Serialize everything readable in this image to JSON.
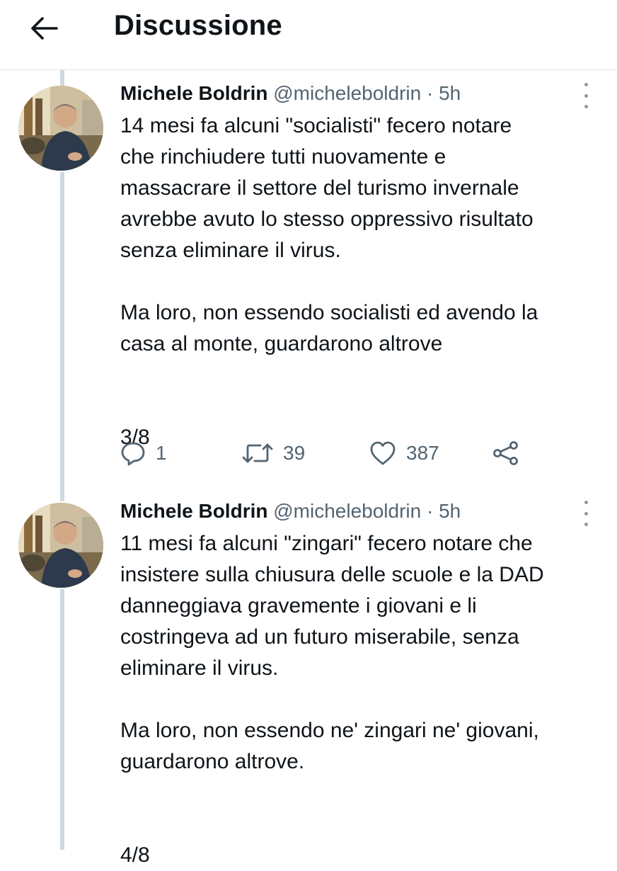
{
  "header": {
    "title": "Discussione"
  },
  "tweets": [
    {
      "name": "Michele Boldrin",
      "handle": "@micheleboldrin",
      "dot": "·",
      "time": "5h",
      "text": "14 mesi fa alcuni \"socialisti\" fecero notare\nche rinchiudere tutti nuovamente e\nmassacrare il settore del turismo invernale\navrebbe avuto lo stesso oppressivo risultato\nsenza eliminare il virus.\n\nMa loro, non essendo socialisti ed avendo la\ncasa al monte, guardarono altrove\n\n\n3/8",
      "replies": "1",
      "retweets": "39",
      "likes": "387"
    },
    {
      "name": "Michele Boldrin",
      "handle": "@micheleboldrin",
      "dot": "·",
      "time": "5h",
      "text": "11 mesi fa alcuni \"zingari\" fecero notare che\ninsistere sulla chiusura delle scuole e la DAD\ndanneggiava gravemente i giovani e li\ncostringeva ad un futuro miserabile, senza\neliminare il virus.\n\nMa loro, non essendo ne' zingari ne' giovani,\nguardarono altrove.\n\n\n4/8"
    }
  ],
  "icons": {
    "back": "arrow-left-icon",
    "more": "more-vertical-icon",
    "reply": "reply-icon",
    "retweet": "retweet-icon",
    "like": "heart-icon",
    "share": "share-icon"
  },
  "colors": {
    "text": "#0f1419",
    "secondary": "#536471",
    "thread_line": "#cfd9de",
    "divider": "#e3e7ea"
  }
}
